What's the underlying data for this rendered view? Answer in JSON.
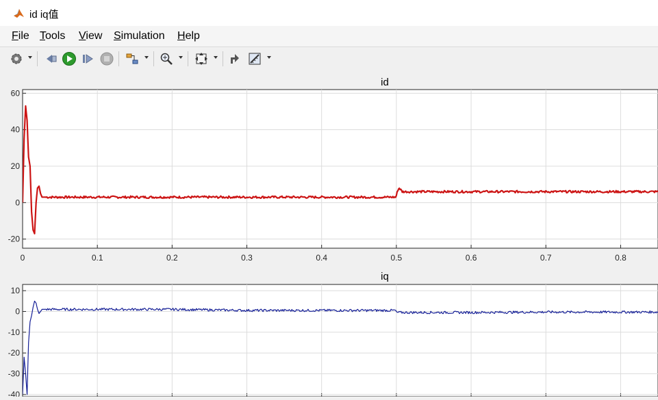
{
  "window": {
    "title": "id iq值"
  },
  "menu": [
    {
      "mn": "F",
      "rest": "ile"
    },
    {
      "mn": "T",
      "rest": "ools"
    },
    {
      "mn": "V",
      "rest": "iew"
    },
    {
      "mn": "S",
      "rest": "imulation"
    },
    {
      "mn": "H",
      "rest": "elp"
    }
  ],
  "toolbar": {
    "icons": [
      "gear-icon",
      "step-back-icon",
      "run-icon",
      "step-forward-icon",
      "stop-icon",
      "highlight-block-icon",
      "zoom-icon",
      "fit-to-view-icon",
      "restore-layout-icon",
      "measure-icon"
    ]
  },
  "colors": {
    "id_line": "#cc1414",
    "iq_line": "#141e96",
    "grid": "#dcdcdc",
    "axes_bg": "#ffffff"
  },
  "chart_data": [
    {
      "type": "line",
      "title": "id",
      "xlim": [
        0,
        0.85
      ],
      "ylim": [
        -25,
        62
      ],
      "xticks": [
        0,
        0.1,
        0.2,
        0.3,
        0.4,
        0.5,
        0.6,
        0.7,
        0.8
      ],
      "yticks": [
        -20,
        0,
        20,
        40,
        60
      ],
      "grid": true,
      "series": [
        {
          "color": "#cc1414",
          "x": [
            0,
            0.002,
            0.004,
            0.006,
            0.008,
            0.01,
            0.012,
            0.014,
            0.016,
            0.018,
            0.02,
            0.022,
            0.024,
            0.026,
            0.028,
            0.03,
            0.035,
            0.05,
            0.1,
            0.2,
            0.3,
            0.4,
            0.499,
            0.5,
            0.502,
            0.504,
            0.506,
            0.508,
            0.51,
            0.52,
            0.6,
            0.7,
            0.8,
            0.85
          ],
          "y": [
            0,
            35,
            53,
            45,
            25,
            20,
            -5,
            -15,
            -17,
            0,
            8,
            9,
            5,
            3,
            3,
            3,
            3,
            3,
            3,
            3,
            3,
            3,
            3,
            4,
            7,
            8,
            7,
            6,
            6,
            6,
            6,
            6,
            6,
            6
          ]
        }
      ]
    },
    {
      "type": "line",
      "title": "iq",
      "xlim": [
        0,
        0.85
      ],
      "ylim": [
        -41,
        13
      ],
      "xticks": [
        0,
        0.1,
        0.2,
        0.3,
        0.4,
        0.5,
        0.6,
        0.7,
        0.8
      ],
      "yticks": [
        -40,
        -30,
        -20,
        -10,
        0,
        10
      ],
      "grid": true,
      "series": [
        {
          "color": "#141e96",
          "x": [
            0,
            0.002,
            0.004,
            0.006,
            0.008,
            0.01,
            0.012,
            0.014,
            0.016,
            0.018,
            0.02,
            0.022,
            0.024,
            0.026,
            0.03,
            0.05,
            0.1,
            0.2,
            0.3,
            0.4,
            0.499,
            0.5,
            0.51,
            0.6,
            0.7,
            0.8,
            0.85
          ],
          "y": [
            -40,
            -22,
            -30,
            -40,
            -15,
            -5,
            -2,
            2,
            5,
            4,
            1,
            -1,
            0,
            1,
            1,
            1,
            1,
            1,
            0.5,
            0.5,
            0.5,
            -0.5,
            -0.5,
            -0.5,
            -0.3,
            -0.3,
            -0.3
          ]
        }
      ]
    }
  ]
}
